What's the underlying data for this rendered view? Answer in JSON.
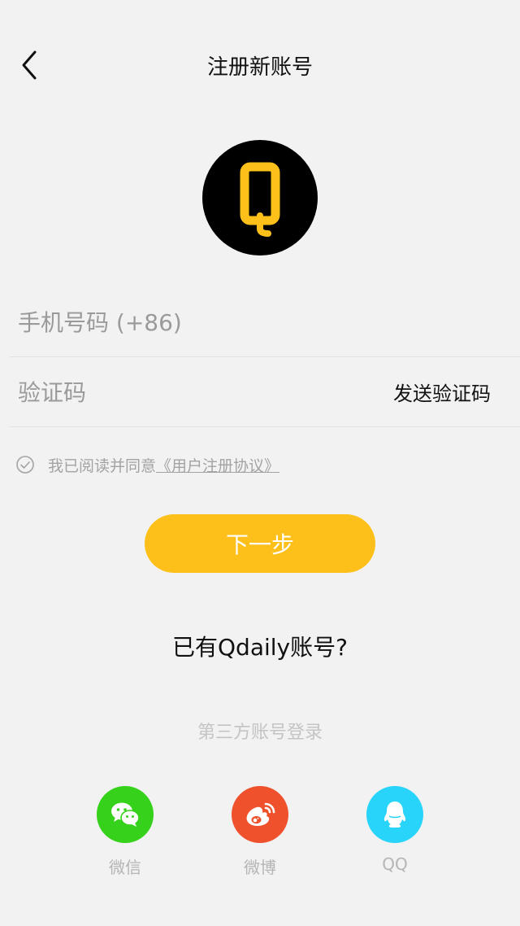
{
  "header": {
    "title": "注册新账号"
  },
  "logo": {
    "letter": "Q",
    "background": "#000000",
    "color": "#fdc01b"
  },
  "form": {
    "phone_placeholder": "手机号码 (+86)",
    "phone_value": "",
    "code_placeholder": "验证码",
    "code_value": "",
    "send_code_label": "发送验证码"
  },
  "agreement": {
    "text": "我已阅读并同意",
    "link": "《用户注册协议》",
    "checked": false
  },
  "next_label": "下一步",
  "have_account": "已有Qdaily账号?",
  "third_party": {
    "title": "第三方账号登录",
    "providers": [
      {
        "label": "微信",
        "icon": "wechat-icon",
        "color": "#36d11a"
      },
      {
        "label": "微博",
        "icon": "weibo-icon",
        "color": "#f0512d"
      },
      {
        "label": "QQ",
        "icon": "qq-icon",
        "color": "#29d4fb"
      }
    ]
  },
  "colors": {
    "accent": "#fdc01b",
    "background": "#f2f2f2"
  }
}
